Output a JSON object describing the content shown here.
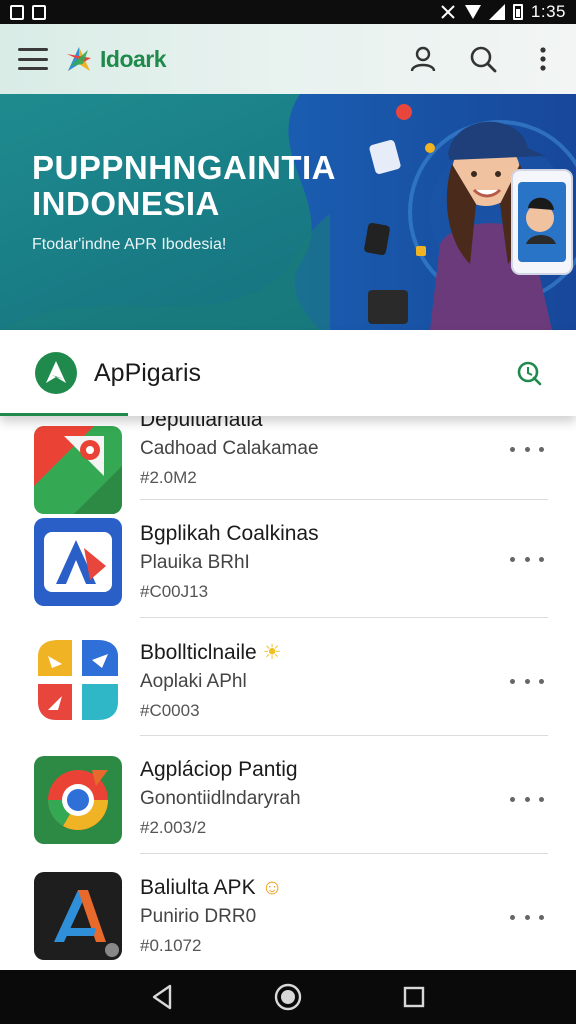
{
  "status_bar": {
    "time": "1:35"
  },
  "app_bar": {
    "brand": "Idoark",
    "icons": [
      "menu-icon",
      "account-icon",
      "search-icon",
      "more-vert-icon"
    ]
  },
  "banner": {
    "title_line1": "PUPPNHNGAINTIA",
    "title_line2": "INDONESIA",
    "subtitle": "Ftodar'indne APR Ibodesia!",
    "colors": {
      "left": "#1c7a86",
      "right": "#1f4fa0"
    }
  },
  "category": {
    "title": "ApPigaris",
    "accent": "#1f8a4c"
  },
  "apps": [
    {
      "name": "Depuitianatia",
      "subtitle": "Cadhoad Calakamae",
      "meta": "#2.0M2"
    },
    {
      "name": "Bgplikah Coalkinas",
      "subtitle": "Plauika BRhI",
      "meta": "#C00J13"
    },
    {
      "name": "Bbollticlnaile",
      "subtitle": "Aoplaki APhl",
      "meta": "#C0003"
    },
    {
      "name": "Agpláciop Pantig",
      "subtitle": "Gonontiidlndaryrah",
      "meta": "#2.003/2"
    },
    {
      "name": "Baliulta APK",
      "subtitle": "Punirio DRR0",
      "meta": "#0.1072"
    }
  ],
  "nav": {
    "icons": [
      "back-icon",
      "home-icon",
      "recents-icon"
    ]
  }
}
